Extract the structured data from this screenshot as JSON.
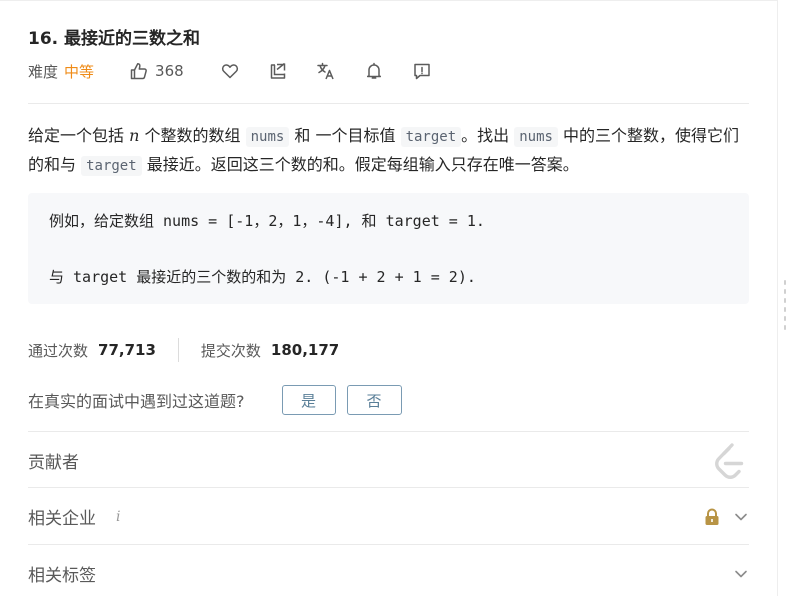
{
  "problem": {
    "number": "16.",
    "title": "最接近的三数之和",
    "difficulty_label": "难度",
    "difficulty_value": "中等",
    "likes": "368"
  },
  "icons": {
    "like": "thumbs-up-icon",
    "favorite": "heart-icon",
    "share": "share-icon",
    "translate": "translate-icon",
    "notify": "bell-icon",
    "feedback": "comment-icon",
    "lock": "lock-icon",
    "expand": "chevron-down-icon",
    "brand": "leetcode-logo-icon"
  },
  "description": {
    "p1": "给定一个包括 ",
    "n": "n",
    "p2": " 个整数的数组 ",
    "code_nums": "nums",
    "p3": " 和 一个目标值 ",
    "code_target": "target",
    "p4": "。找出 ",
    "code_nums2": "nums",
    "p5": " 中的三个整数，使得它们的和与 ",
    "code_target2": "target",
    "p6": " 最接近。返回这三个数的和。假定每组输入只存在唯一答案。"
  },
  "example": {
    "line1": "例如，给定数组 nums = [-1，2，1，-4], 和 target = 1.",
    "line2": "与 target 最接近的三个数的和为 2. (-1 + 2 + 1 = 2)."
  },
  "stats": {
    "accepted_label": "通过次数",
    "accepted_value": "77,713",
    "submitted_label": "提交次数",
    "submitted_value": "180,177"
  },
  "interview": {
    "question": "在真实的面试中遇到过这道题?",
    "yes": "是",
    "no": "否"
  },
  "sections": {
    "contributors": "贡献者",
    "companies": "相关企业",
    "companies_info": "i",
    "tags": "相关标签"
  },
  "colors": {
    "difficulty_medium": "#ef8b17",
    "lock": "#b89445",
    "button_border": "#7a9bb3"
  }
}
